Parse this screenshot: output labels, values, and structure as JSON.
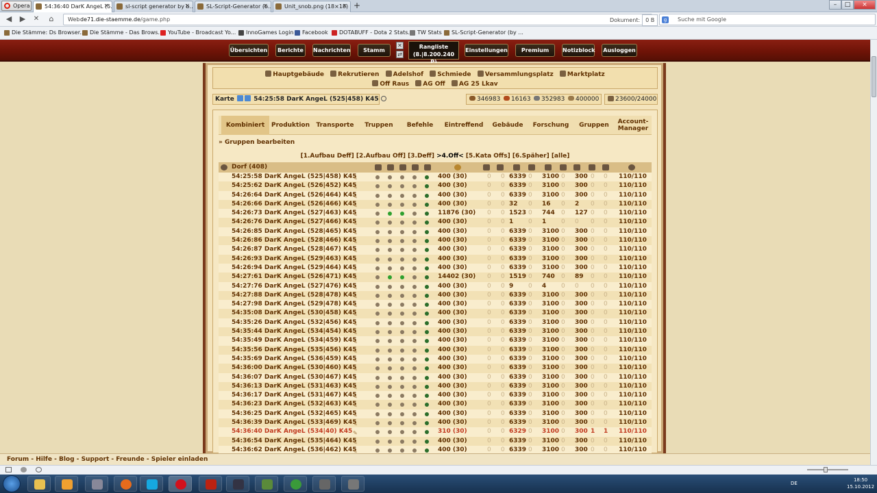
{
  "browser": {
    "opera_label": "Opera",
    "tabs": [
      {
        "label": "54:36:40 DarK AngeL (5..."
      },
      {
        "label": "sl-script generator by b..."
      },
      {
        "label": "SL-Script-Generator (b..."
      },
      {
        "label": "Unit_snob.png (18×18)"
      }
    ],
    "url_prefix": "Web",
    "url_domain": "de71.die-staemme.de",
    "url_path": "/game.php",
    "doc_label": "Dokument:",
    "doc_size": "0 B",
    "search_placeholder": "Suche mit Google",
    "bookmarks": [
      "Die Stämme: Ds Browser...",
      "Die Stämme - Das Brows...",
      "YouTube - Broadcast Yo...",
      "InnoGames Login",
      "Facebook",
      "DOTABUFF - Dota 2 Stats...",
      "TW Stats",
      "SL-Script-Generator (by ..."
    ]
  },
  "menu": {
    "items": [
      "Übersichten",
      "Berichte",
      "Nachrichten",
      "Stamm",
      "Einstellungen",
      "Premium",
      "Notizblock",
      "Ausloggen"
    ],
    "rank_title": "Rangliste",
    "rank_value": "(8.|8.200.240 P)"
  },
  "buildings": {
    "row1": [
      "Hauptgebäude",
      "Rekrutieren",
      "Adelshof",
      "Schmiede",
      "Versammlungsplatz",
      "Marktplatz"
    ],
    "row2": [
      "Off Raus",
      "AG Off",
      "AG 25 Lkav"
    ]
  },
  "village": {
    "map_label": "Karte",
    "name": "54:25:58 DarK AngeL (525|458) K45"
  },
  "resources": {
    "wood": "346983",
    "clay": "16163",
    "iron": "352983",
    "storage": "400000",
    "population": "23600/24000"
  },
  "subtabs": [
    "Kombiniert",
    "Produktion",
    "Transporte",
    "Truppen",
    "Befehle",
    "Eintreffend",
    "Gebäude",
    "Forschung",
    "Gruppen",
    "Account-\nManager"
  ],
  "groups_edit": "» Gruppen bearbeiten",
  "filters": {
    "before": "[1.Aufbau Deff] [2.Aufbau Off] [3.Deff] ",
    "current": ">4.Off<",
    "after": " [5.Kata Offs] [6.Späher] [alle]"
  },
  "table": {
    "header_village": "Dorf (408)",
    "rows": [
      {
        "village": "54:25:58 DarK AngeL (525|458) K45",
        "farm": "400 (30)",
        "u": [
          "0",
          "0",
          "6339",
          "0",
          "3100",
          "0",
          "300",
          "0",
          "0"
        ],
        "loyalty": "110/110",
        "dots": "nnnng"
      },
      {
        "village": "54:25:62 DarK AngeL (526|452) K45",
        "farm": "400 (30)",
        "u": [
          "0",
          "0",
          "6339",
          "0",
          "3100",
          "0",
          "300",
          "0",
          "0"
        ],
        "loyalty": "110/110",
        "dots": "nnnng"
      },
      {
        "village": "54:26:64 DarK AngeL (526|464) K45",
        "farm": "400 (30)",
        "u": [
          "0",
          "0",
          "6339",
          "0",
          "3100",
          "0",
          "300",
          "0",
          "0"
        ],
        "loyalty": "110/110",
        "dots": "nnnng"
      },
      {
        "village": "54:26:66 DarK AngeL (526|466) K45",
        "farm": "400 (30)",
        "u": [
          "0",
          "0",
          "32",
          "0",
          "16",
          "0",
          "2",
          "0",
          "0"
        ],
        "loyalty": "110/110",
        "dots": "nnnng"
      },
      {
        "village": "54:26:73 DarK AngeL (527|463) K45",
        "farm": "11876 (30)",
        "u": [
          "0",
          "0",
          "1523",
          "0",
          "744",
          "0",
          "127",
          "0",
          "0"
        ],
        "loyalty": "110/110",
        "dots": "nggng"
      },
      {
        "village": "54:26:76 DarK AngeL (527|466) K45",
        "farm": "400 (30)",
        "u": [
          "0",
          "0",
          "1",
          "0",
          "1",
          "0",
          "0",
          "0",
          "0"
        ],
        "loyalty": "110/110",
        "dots": "nnnng"
      },
      {
        "village": "54:26:85 DarK AngeL (528|465) K45",
        "farm": "400 (30)",
        "u": [
          "0",
          "0",
          "6339",
          "0",
          "3100",
          "0",
          "300",
          "0",
          "0"
        ],
        "loyalty": "110/110",
        "dots": "nnnng"
      },
      {
        "village": "54:26:86 DarK AngeL (528|466) K45",
        "farm": "400 (30)",
        "u": [
          "0",
          "0",
          "6339",
          "0",
          "3100",
          "0",
          "300",
          "0",
          "0"
        ],
        "loyalty": "110/110",
        "dots": "nnnng"
      },
      {
        "village": "54:26:87 DarK AngeL (528|467) K45",
        "farm": "400 (30)",
        "u": [
          "0",
          "0",
          "6339",
          "0",
          "3100",
          "0",
          "300",
          "0",
          "0"
        ],
        "loyalty": "110/110",
        "dots": "nnnng"
      },
      {
        "village": "54:26:93 DarK AngeL (529|463) K45",
        "farm": "400 (30)",
        "u": [
          "0",
          "0",
          "6339",
          "0",
          "3100",
          "0",
          "300",
          "0",
          "0"
        ],
        "loyalty": "110/110",
        "dots": "nnnng"
      },
      {
        "village": "54:26:94 DarK AngeL (529|464) K45",
        "farm": "400 (30)",
        "u": [
          "0",
          "0",
          "6339",
          "0",
          "3100",
          "0",
          "300",
          "0",
          "0"
        ],
        "loyalty": "110/110",
        "dots": "nnnng"
      },
      {
        "village": "54:27:61 DarK AngeL (526|471) K45",
        "farm": "14402 (30)",
        "u": [
          "0",
          "0",
          "1519",
          "0",
          "740",
          "0",
          "89",
          "0",
          "0"
        ],
        "loyalty": "110/110",
        "dots": "nggng"
      },
      {
        "village": "54:27:76 DarK AngeL (527|476) K45",
        "farm": "400 (30)",
        "u": [
          "0",
          "0",
          "9",
          "0",
          "4",
          "0",
          "0",
          "0",
          "0"
        ],
        "loyalty": "110/110",
        "dots": "nnnng"
      },
      {
        "village": "54:27:88 DarK AngeL (528|478) K45",
        "farm": "400 (30)",
        "u": [
          "0",
          "0",
          "6339",
          "0",
          "3100",
          "0",
          "300",
          "0",
          "0"
        ],
        "loyalty": "110/110",
        "dots": "nnnng"
      },
      {
        "village": "54:27:98 DarK AngeL (529|478) K45",
        "farm": "400 (30)",
        "u": [
          "0",
          "0",
          "6339",
          "0",
          "3100",
          "0",
          "300",
          "0",
          "0"
        ],
        "loyalty": "110/110",
        "dots": "nnnng"
      },
      {
        "village": "54:35:08 DarK AngeL (530|458) K45",
        "farm": "400 (30)",
        "u": [
          "0",
          "0",
          "6339",
          "0",
          "3100",
          "0",
          "300",
          "0",
          "0"
        ],
        "loyalty": "110/110",
        "dots": "nnnng"
      },
      {
        "village": "54:35:26 DarK AngeL (532|456) K45",
        "farm": "400 (30)",
        "u": [
          "0",
          "0",
          "6339",
          "0",
          "3100",
          "0",
          "300",
          "0",
          "0"
        ],
        "loyalty": "110/110",
        "dots": "nnnng"
      },
      {
        "village": "54:35:44 DarK AngeL (534|454) K45",
        "farm": "400 (30)",
        "u": [
          "0",
          "0",
          "6339",
          "0",
          "3100",
          "0",
          "300",
          "0",
          "0"
        ],
        "loyalty": "110/110",
        "dots": "nnnng"
      },
      {
        "village": "54:35:49 DarK AngeL (534|459) K45",
        "farm": "400 (30)",
        "u": [
          "0",
          "0",
          "6339",
          "0",
          "3100",
          "0",
          "300",
          "0",
          "0"
        ],
        "loyalty": "110/110",
        "dots": "nnnng"
      },
      {
        "village": "54:35:56 DarK AngeL (535|456) K45",
        "farm": "400 (30)",
        "u": [
          "0",
          "0",
          "6339",
          "0",
          "3100",
          "0",
          "300",
          "0",
          "0"
        ],
        "loyalty": "110/110",
        "dots": "nnnng"
      },
      {
        "village": "54:35:69 DarK AngeL (536|459) K45",
        "farm": "400 (30)",
        "u": [
          "0",
          "0",
          "6339",
          "0",
          "3100",
          "0",
          "300",
          "0",
          "0"
        ],
        "loyalty": "110/110",
        "dots": "nnnng"
      },
      {
        "village": "54:36:00 DarK AngeL (530|460) K45",
        "farm": "400 (30)",
        "u": [
          "0",
          "0",
          "6339",
          "0",
          "3100",
          "0",
          "300",
          "0",
          "0"
        ],
        "loyalty": "110/110",
        "dots": "nnnng"
      },
      {
        "village": "54:36:07 DarK AngeL (530|467) K45",
        "farm": "400 (30)",
        "u": [
          "0",
          "0",
          "6339",
          "0",
          "3100",
          "0",
          "300",
          "0",
          "0"
        ],
        "loyalty": "110/110",
        "dots": "nnnng"
      },
      {
        "village": "54:36:13 DarK AngeL (531|463) K45",
        "farm": "400 (30)",
        "u": [
          "0",
          "0",
          "6339",
          "0",
          "3100",
          "0",
          "300",
          "0",
          "0"
        ],
        "loyalty": "110/110",
        "dots": "nnnng"
      },
      {
        "village": "54:36:17 DarK AngeL (531|467) K45",
        "farm": "400 (30)",
        "u": [
          "0",
          "0",
          "6339",
          "0",
          "3100",
          "0",
          "300",
          "0",
          "0"
        ],
        "loyalty": "110/110",
        "dots": "nnnng"
      },
      {
        "village": "54:36:23 DarK AngeL (532|463) K45",
        "farm": "400 (30)",
        "u": [
          "0",
          "0",
          "6339",
          "0",
          "3100",
          "0",
          "300",
          "0",
          "0"
        ],
        "loyalty": "110/110",
        "dots": "nnnng"
      },
      {
        "village": "54:36:25 DarK AngeL (532|465) K45",
        "farm": "400 (30)",
        "u": [
          "0",
          "0",
          "6339",
          "0",
          "3100",
          "0",
          "300",
          "0",
          "0"
        ],
        "loyalty": "110/110",
        "dots": "nnnng"
      },
      {
        "village": "54:36:39 DarK AngeL (533|469) K45",
        "farm": "400 (30)",
        "u": [
          "0",
          "0",
          "6339",
          "0",
          "3100",
          "0",
          "300",
          "0",
          "0"
        ],
        "loyalty": "110/110",
        "dots": "nnnng"
      },
      {
        "village": "54:36:40 DarK AngeL (534|4",
        "village_tail": "0) K45",
        "farm": "310 (30)",
        "u": [
          "0",
          "0",
          "6329",
          "0",
          "3100",
          "0",
          "300",
          "1",
          "1"
        ],
        "loyalty": "110/110",
        "dots": "nnnng",
        "marked": true
      },
      {
        "village": "54:36:54 DarK AngeL (535|464) K45",
        "farm": "400 (30)",
        "u": [
          "0",
          "0",
          "6339",
          "0",
          "3100",
          "0",
          "300",
          "0",
          "0"
        ],
        "loyalty": "110/110",
        "dots": "nnnng"
      },
      {
        "village": "54:36:62 DarK AngeL (536|462) K45",
        "farm": "400 (30)",
        "u": [
          "0",
          "0",
          "6339",
          "0",
          "3100",
          "0",
          "300",
          "0",
          "0"
        ],
        "loyalty": "110/110",
        "dots": "nnnng"
      }
    ]
  },
  "footer_links": [
    "Forum",
    "Hilfe",
    "Blog",
    "Support",
    "Freunde",
    "Spieler einladen"
  ],
  "taskbar": {
    "lang": "DE",
    "time": "18:50",
    "date": "15.10.2012"
  },
  "colors": {
    "menu_bg": "#6d1307",
    "text_brown": "#603000",
    "marked_row": "#c0391e"
  }
}
